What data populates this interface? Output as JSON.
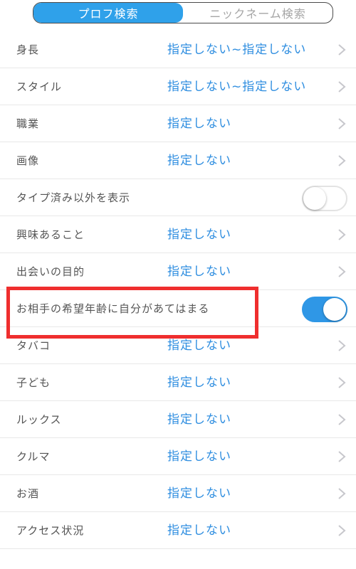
{
  "tabs": {
    "profile_search": "プロフ検索",
    "nickname_search": "ニックネーム検索"
  },
  "colors": {
    "accent": "#2fa1ea",
    "value_text": "#2f8ee0",
    "highlight_frame": "#ef2e2e"
  },
  "rows": [
    {
      "label": "身長",
      "value": "指定しない~指定しない",
      "control": "chevron-right-icon"
    },
    {
      "label": "スタイル",
      "value": "指定しない~指定しない",
      "control": "chevron-right-icon"
    },
    {
      "label": "職業",
      "value": "指定しない",
      "control": "chevron-right-icon"
    },
    {
      "label": "画像",
      "value": "指定しない",
      "control": "chevron-right-icon"
    },
    {
      "label": "タイプ済み以外を表示",
      "toggle_on": false
    },
    {
      "label": "興味あること",
      "value": "指定しない",
      "control": "chevron-right-icon"
    },
    {
      "label": "出会いの目的",
      "value": "指定しない",
      "control": "chevron-right-icon"
    },
    {
      "label": "お相手の希望年齢に自分があてはまる",
      "toggle_on": true
    },
    {
      "label": "タバコ",
      "value": "指定しない",
      "control": "chevron-right-icon"
    },
    {
      "label": "子ども",
      "value": "指定しない",
      "control": "chevron-right-icon"
    },
    {
      "label": "ルックス",
      "value": "指定しない",
      "control": "chevron-right-icon"
    },
    {
      "label": "クルマ",
      "value": "指定しない",
      "control": "chevron-right-icon"
    },
    {
      "label": "お酒",
      "value": "指定しない",
      "control": "chevron-right-icon"
    },
    {
      "label": "アクセス状況",
      "value": "指定しない",
      "control": "chevron-right-icon"
    }
  ]
}
